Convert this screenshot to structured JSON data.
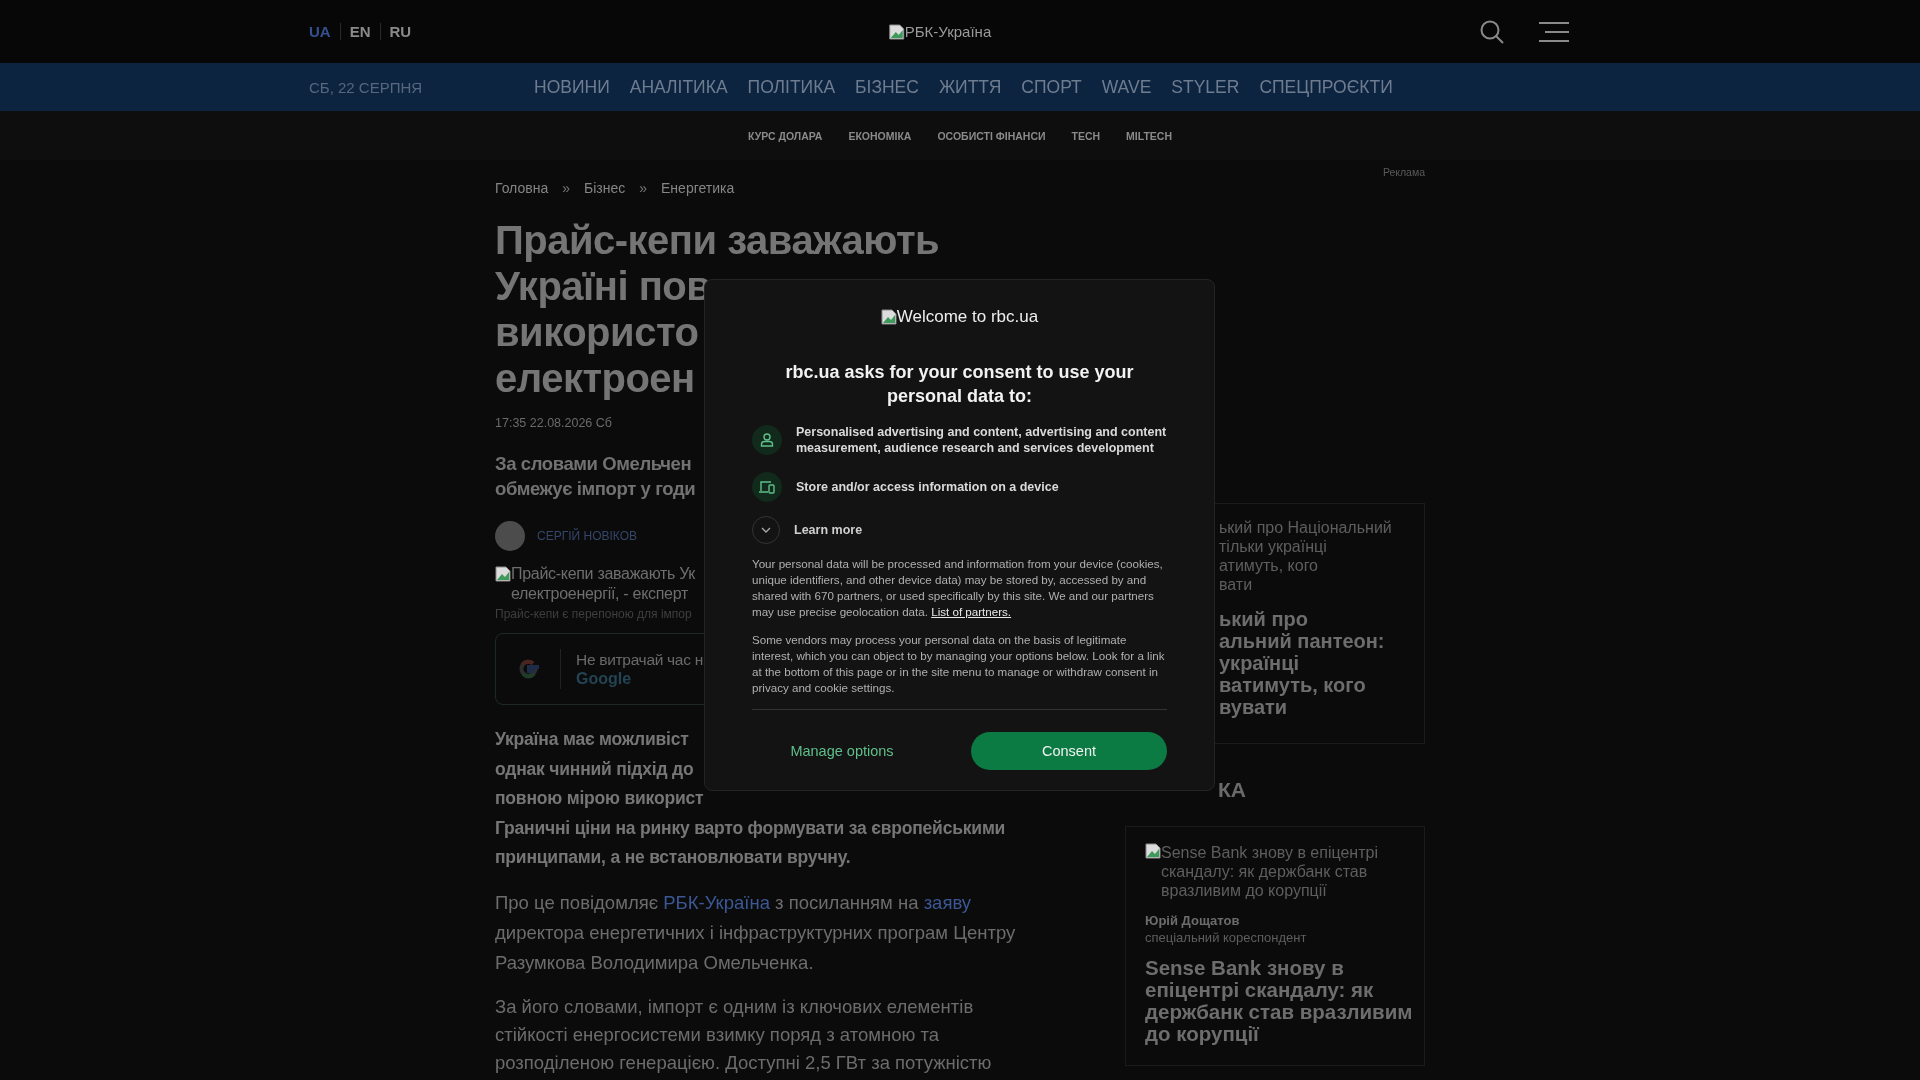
{
  "header": {
    "languages": [
      {
        "label": "UA",
        "selected": true
      },
      {
        "label": "EN",
        "selected": false
      },
      {
        "label": "RU",
        "selected": false
      }
    ],
    "logo_alt": "РБК-Україна"
  },
  "nav": {
    "date": "СБ, 22 СЕРПНЯ",
    "items": [
      "НОВИНИ",
      "АНАЛІТИКА",
      "ПОЛІТИКА",
      "БІЗНЕС",
      "ЖИТТЯ",
      "СПОРТ",
      "WAVE",
      "STYLER",
      "СПЕЦПРОЄКТИ"
    ]
  },
  "subnav": [
    "КУРС ДОЛАРА",
    "ЕКОНОМІКА",
    "ОСОБИСТІ ФІНАНСИ",
    "TECH",
    "MILTECH"
  ],
  "ad_label": "Реклама",
  "article": {
    "breadcrumbs": [
      {
        "kind": "link",
        "text": "Головна"
      },
      {
        "kind": "separator",
        "text": "»"
      },
      {
        "kind": "link",
        "text": "Бізнес"
      },
      {
        "kind": "separator",
        "text": "»"
      },
      {
        "kind": "link",
        "text": "Енергетика"
      }
    ],
    "title_lines": [
      "Прайс-кепи заважають",
      "Україні пов",
      "використо",
      "електроен"
    ],
    "date": "17:35 22.08.2026 Сб",
    "lead_lines": [
      "За словами Омельчен",
      "обмежує імпорт у годи"
    ],
    "author": "СЕРГІЙ НОВІКОВ",
    "image_alt_lines": [
      "Прайс-кепи заважають Ук",
      "електроенергії, - експерт"
    ],
    "caption": "Прайс-кепи є перепоною для імпор",
    "google_promo": {
      "text": "Не витрачай час н",
      "link": "Google"
    },
    "paragraphs": [
      {
        "kind": "bold",
        "lines": [
          [
            {
              "kind": "text",
              "text": "Україна має можливіст"
            }
          ],
          [
            {
              "kind": "text",
              "text": "однак чинний підхід до"
            }
          ],
          [
            {
              "kind": "text",
              "text": "повною мірою використ"
            }
          ],
          [
            {
              "kind": "text",
              "text": "Граничні ціни на ринку варто формувати за європейськими"
            }
          ],
          [
            {
              "kind": "text",
              "text": "принципами, а не встановлювати вручну."
            }
          ]
        ]
      },
      {
        "kind": "normal",
        "lines": [
          [
            {
              "kind": "text",
              "text": "Про це повідомляє "
            },
            {
              "kind": "link",
              "text": "РБК-Україна"
            },
            {
              "kind": "text",
              "text": " з посиланням на "
            },
            {
              "kind": "link",
              "text": "заяву"
            }
          ],
          [
            {
              "kind": "text",
              "text": "директора енергетичних і інфраструктурних програм Центру"
            }
          ],
          [
            {
              "kind": "text",
              "text": "Разумкова Володимира Омельченка."
            }
          ]
        ]
      },
      {
        "kind": "normal",
        "lines": [
          [
            {
              "kind": "text",
              "text": "За його словами, імпорт є одним із ключових елементів"
            }
          ],
          [
            {
              "kind": "text",
              "text": "стійкості енергосистеми взимку поряд з атомною та"
            }
          ],
          [
            {
              "kind": "text",
              "text": "розподіленою генерацією. Доступні 2,5 ГВт за потужністю"
            }
          ]
        ]
      }
    ]
  },
  "sidebar": {
    "top_card": {
      "image_alt_lines": [
        "ький про Національний",
        "тільки українці",
        "атимуть, кого",
        "вати"
      ],
      "title_lines": [
        "ький про",
        "альний пантеон:",
        "українці",
        "ватимуть, кого",
        "вувати"
      ]
    },
    "section_title": "КА",
    "card": {
      "image_alt_lines": [
        "Sense Bank знову в епіцентрі",
        "скандалу: як держбанк став",
        "вразливим до корупції"
      ],
      "author": "Юрій Дощатов",
      "role": "спеціальний кореспондент",
      "title_lines": [
        "Sense Bank знову в",
        "епіцентрі скандалу: як",
        "держбанк став вразливим",
        "до корупції"
      ]
    }
  },
  "consent": {
    "logo_alt": "Welcome to rbc.ua",
    "heading": "rbc.ua asks for your consent to use your personal data to:",
    "purposes": [
      {
        "kind": "person",
        "text": "Personalised advertising and content, advertising and content measurement, audience research and services development"
      },
      {
        "kind": "device",
        "text": "Store and/or access information on a device"
      }
    ],
    "learn_more": {
      "label": "Learn more",
      "expanded": false
    },
    "paragraphs": [
      {
        "text": "Your personal data will be processed and information from your device (cookies, unique identifiers, and other device data) may be stored by, accessed by and shared with 670 partners, or used specifically by this site. We and our partners may use precise geolocation data.",
        "link": "List of partners."
      },
      {
        "text": "Some vendors may process your personal data on the basis of legitimate interest, which you can object to by managing your options below. Look for a link at the bottom of this page or in the site menu to manage or withdraw consent in privacy and cookie settings."
      }
    ],
    "buttons": [
      {
        "kind": "secondary",
        "label": "Manage options"
      },
      {
        "kind": "primary",
        "label": "Consent"
      }
    ]
  }
}
